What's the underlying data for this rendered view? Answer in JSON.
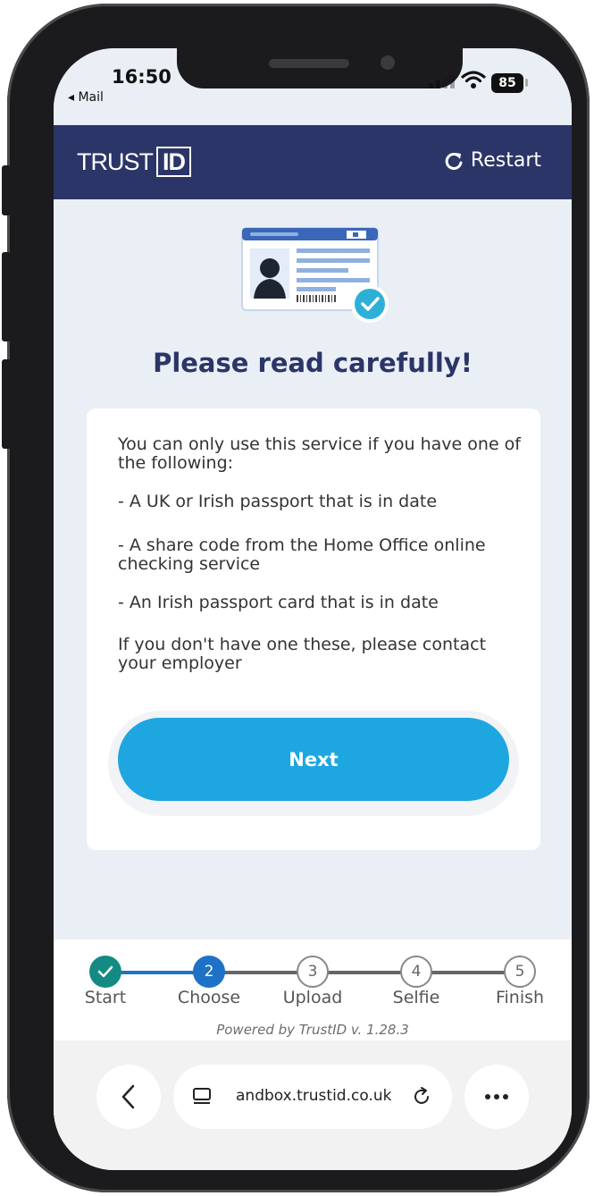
{
  "status_bar": {
    "time": "16:50",
    "back_app": "◂ Mail",
    "battery": "85"
  },
  "header": {
    "logo_left": "TRUST",
    "logo_boxed": "ID",
    "restart_label": "Restart"
  },
  "main": {
    "title": "Please read carefully!",
    "intro": "You can only use this service if you have one of the following:",
    "options": [
      "- A UK or Irish passport that is in date",
      "- A share code from the Home Office online checking service",
      "- An Irish passport card that is in date"
    ],
    "footer_note": "If you don't have one these, please contact your employer",
    "next_label": "Next"
  },
  "stepper": {
    "current_step": 2,
    "steps": [
      {
        "number": "",
        "label": "Start",
        "state": "done"
      },
      {
        "number": "2",
        "label": "Choose",
        "state": "active"
      },
      {
        "number": "3",
        "label": "Upload",
        "state": "todo"
      },
      {
        "number": "4",
        "label": "Selfie",
        "state": "todo"
      },
      {
        "number": "5",
        "label": "Finish",
        "state": "todo"
      }
    ],
    "powered_by": "Powered by TrustID v. 1.28.3"
  },
  "browser": {
    "url": "andbox.trustid.co.uk"
  },
  "colors": {
    "brand_navy": "#2c3567",
    "button_blue": "#1ea6e0",
    "step_done": "#148a83",
    "step_active": "#1d72c7"
  },
  "icons": [
    "id-card-check-icon",
    "restart-icon",
    "check-icon",
    "back-chevron-icon",
    "tabs-icon",
    "reload-icon",
    "more-icon"
  ]
}
